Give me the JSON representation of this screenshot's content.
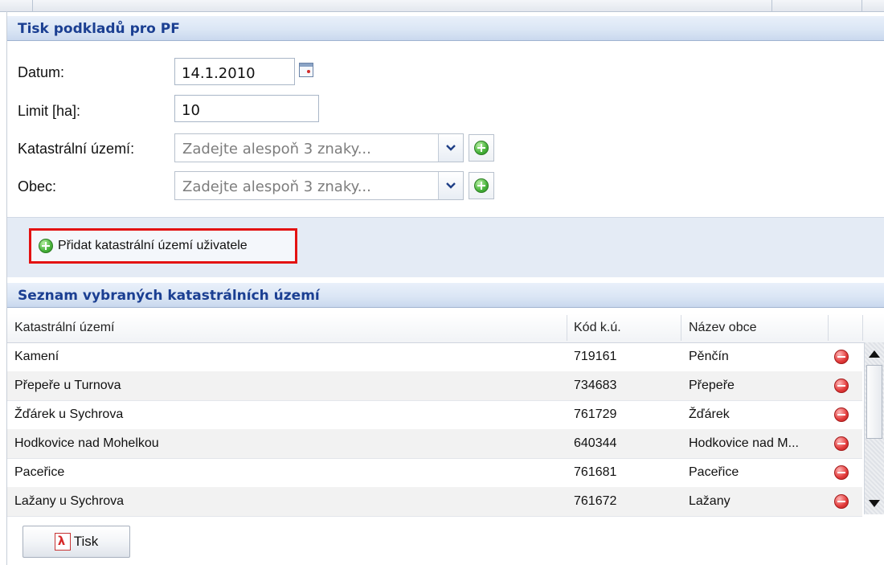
{
  "panel1": {
    "title": "Tisk podkladů pro PF"
  },
  "form": {
    "datum": {
      "label": "Datum:",
      "value": "14.1.2010"
    },
    "limit": {
      "label": "Limit [ha]:",
      "value": "10"
    },
    "katastralni_uzemi": {
      "label": "Katastrální území:",
      "placeholder": "Zadejte alespoň 3 znaky..."
    },
    "obec": {
      "label": "Obec:",
      "placeholder": "Zadejte alespoň 3 znaky..."
    },
    "add_user_button_label": "Přidat katastrální území uživatele"
  },
  "panel2": {
    "title": "Seznam vybraných katastrálních území"
  },
  "grid": {
    "columns": [
      "Katastrální území",
      "Kód k.ú.",
      "Název obce"
    ],
    "rows": [
      {
        "ku": "Kamení",
        "kod": "719161",
        "obec": "Pěnčín"
      },
      {
        "ku": "Přepeře u Turnova",
        "kod": "734683",
        "obec": "Přepeře"
      },
      {
        "ku": "Žďárek u Sychrova",
        "kod": "761729",
        "obec": "Žďárek"
      },
      {
        "ku": "Hodkovice nad Mohelkou",
        "kod": "640344",
        "obec": "Hodkovice nad M..."
      },
      {
        "ku": "Paceřice",
        "kod": "761681",
        "obec": "Paceřice"
      },
      {
        "ku": "Lažany u Sychrova",
        "kod": "761672",
        "obec": "Lažany"
      }
    ]
  },
  "print_button": {
    "label": "Tisk",
    "icon": "pdf-icon"
  },
  "colors": {
    "header_text": "#1b3f92",
    "highlight_outline": "#e31212",
    "add_icon": "#47b23a",
    "remove_icon": "#e23b3b"
  }
}
